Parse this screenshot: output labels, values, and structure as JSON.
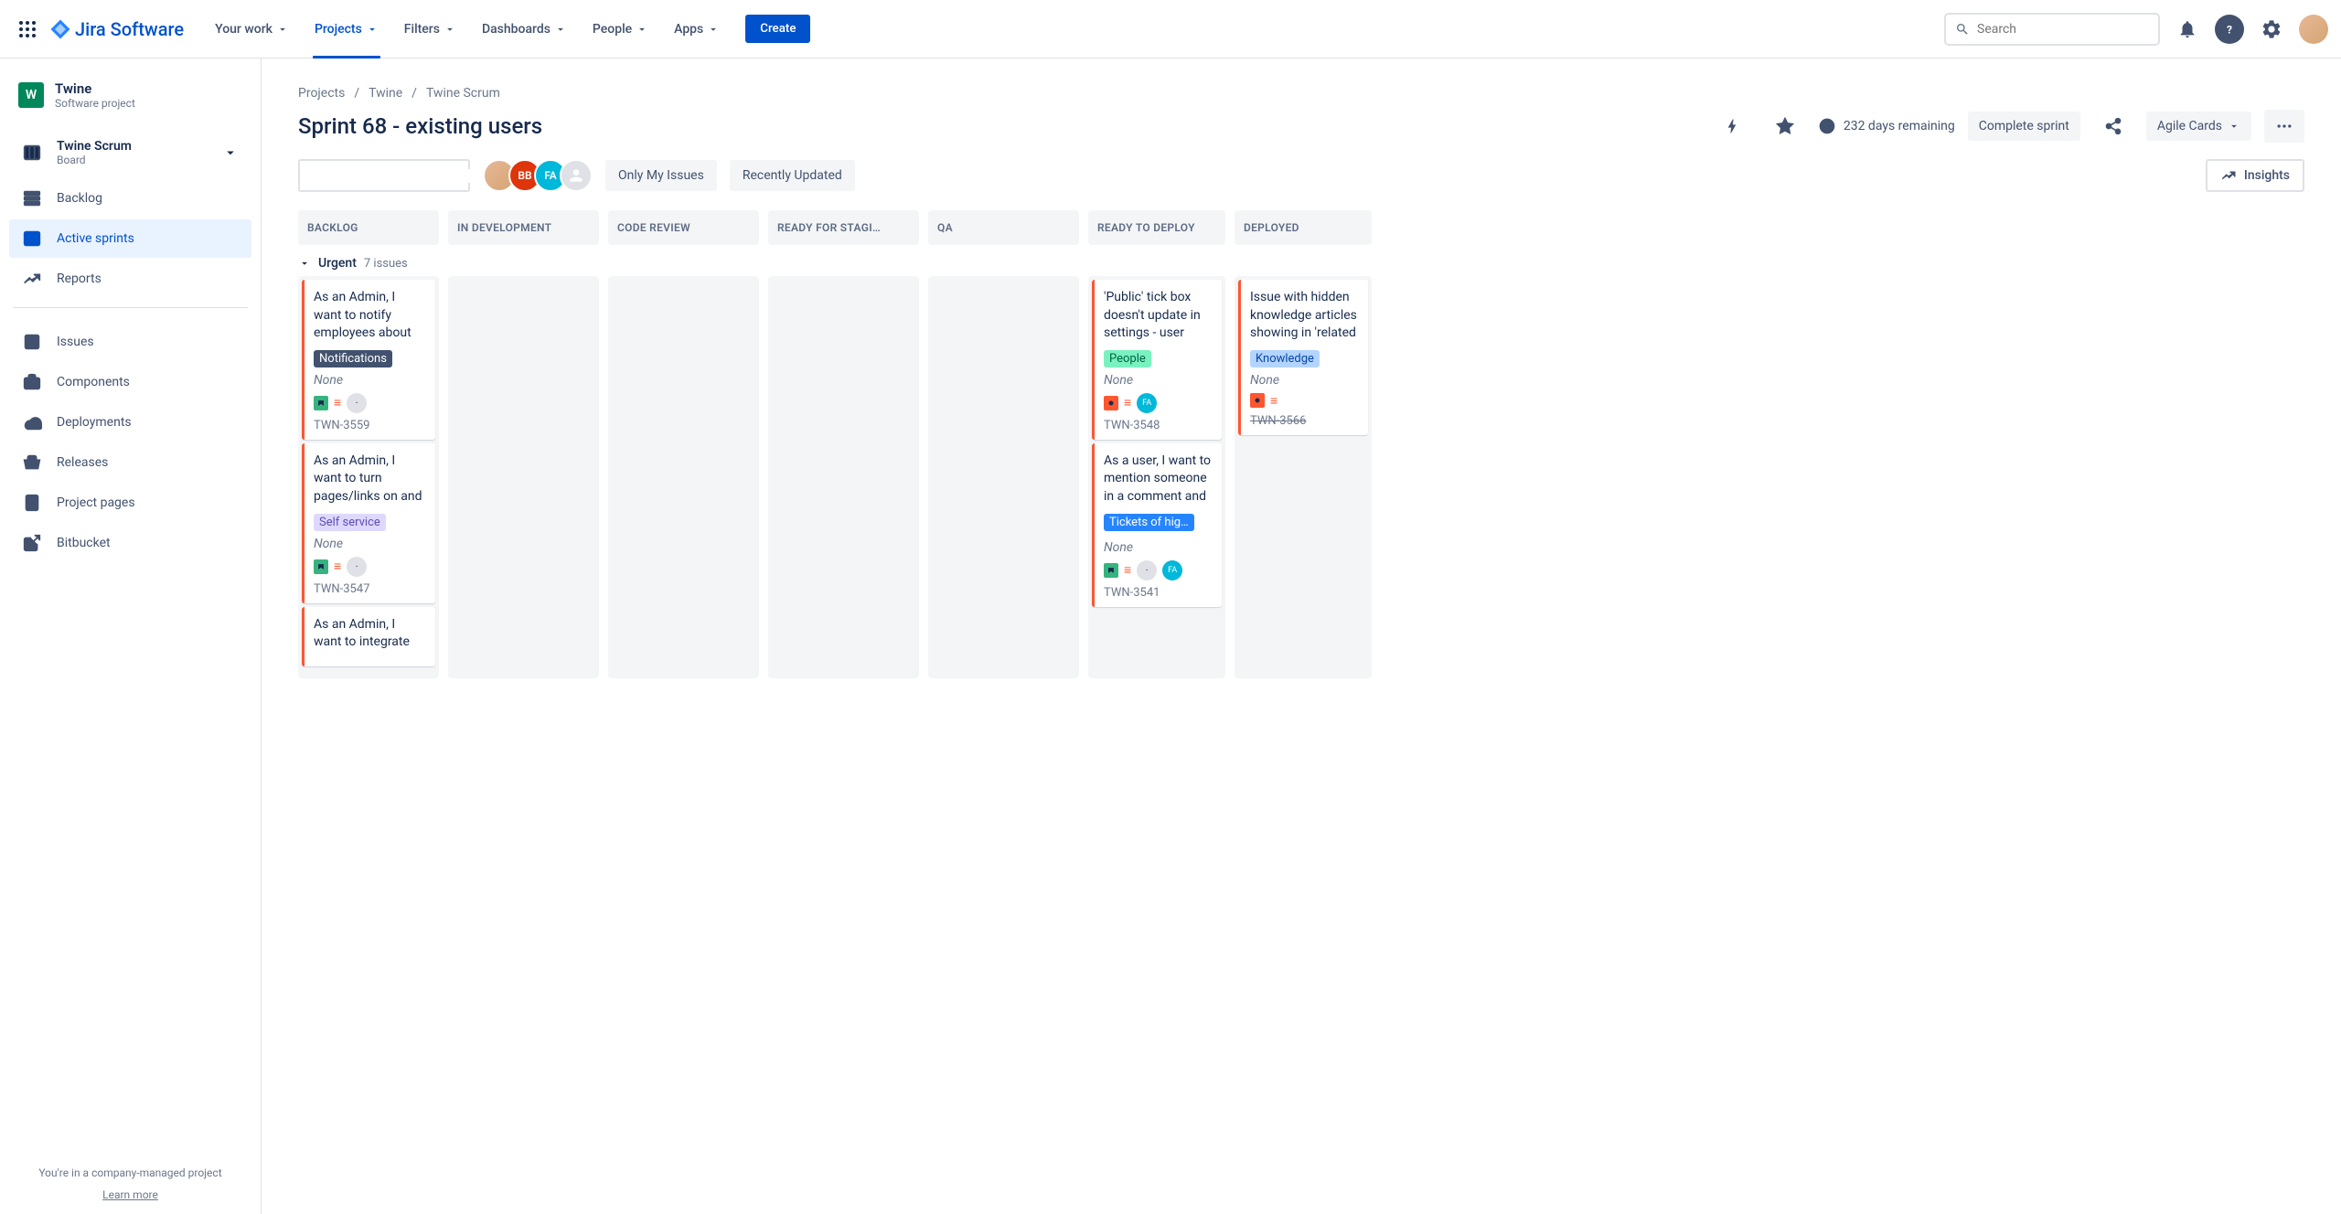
{
  "product_name": "Jira Software",
  "nav": {
    "your_work": "Your work",
    "projects": "Projects",
    "filters": "Filters",
    "dashboards": "Dashboards",
    "people": "People",
    "apps": "Apps",
    "create": "Create"
  },
  "search_placeholder": "Search",
  "project": {
    "name": "Twine",
    "type": "Software project",
    "board_name": "Twine Scrum",
    "board_label": "Board"
  },
  "side_nav": {
    "backlog": "Backlog",
    "active_sprints": "Active sprints",
    "reports": "Reports",
    "issues": "Issues",
    "components": "Components",
    "deployments": "Deployments",
    "releases": "Releases",
    "project_pages": "Project pages",
    "bitbucket": "Bitbucket"
  },
  "sidebar_footer": {
    "line1": "You're in a company-managed project",
    "learn_more": "Learn more"
  },
  "breadcrumb": {
    "projects": "Projects",
    "project": "Twine",
    "board": "Twine Scrum"
  },
  "sprint": {
    "title": "Sprint 68 - existing users",
    "remaining": "232 days remaining",
    "complete_btn": "Complete sprint",
    "agile_cards": "Agile Cards"
  },
  "toolbar": {
    "only_my": "Only My Issues",
    "recently_updated": "Recently Updated",
    "insights": "Insights"
  },
  "assignee_initials": [
    "",
    "BB",
    "FA",
    ""
  ],
  "columns": [
    "BACKLOG",
    "IN DEVELOPMENT",
    "CODE REVIEW",
    "READY FOR STAGI…",
    "QA",
    "READY TO DEPLOY",
    "DEPLOYED"
  ],
  "swimlane": {
    "name": "Urgent",
    "count": "7 issues"
  },
  "cards": {
    "backlog": [
      {
        "title": "As an Admin, I want to notify employees about",
        "epic": "Notifications",
        "epic_class": "epic-notif",
        "none": "None",
        "key": "TWN-3559",
        "type": "story",
        "assignee": "-"
      },
      {
        "title": "As an Admin, I want to turn pages/links on and",
        "epic": "Self service",
        "epic_class": "epic-self",
        "none": "None",
        "key": "TWN-3547",
        "type": "story",
        "assignee": "-"
      },
      {
        "title": "As an Admin, I want to integrate",
        "epic": "",
        "epic_class": "",
        "none": "",
        "key": "",
        "type": "",
        "assignee": ""
      }
    ],
    "ready_to_deploy": [
      {
        "title": "'Public' tick box doesn't update in settings - user",
        "epic": "People",
        "epic_class": "epic-people",
        "none": "None",
        "key": "TWN-3548",
        "type": "bug",
        "assignee": "FA"
      },
      {
        "title": "As a user, I want to mention someone in a comment and",
        "epic": "Tickets of hig…",
        "epic_class": "epic-tickets",
        "none": "None",
        "key": "TWN-3541",
        "type": "story",
        "assignee": "- FA"
      }
    ],
    "deployed": [
      {
        "title": "Issue with hidden knowledge articles showing in 'related",
        "epic": "Knowledge",
        "epic_class": "epic-know",
        "none": "None",
        "key": "TWN-3566",
        "type": "bug",
        "done": true
      }
    ]
  }
}
